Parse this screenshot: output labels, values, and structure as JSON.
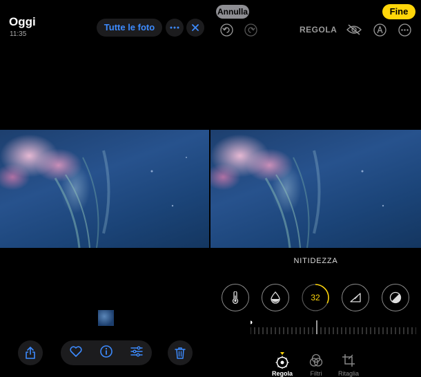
{
  "left": {
    "title": "Oggi",
    "time": "11:35",
    "all_photos_label": "Tutte le foto",
    "icons": {
      "more": "ellipsis-icon",
      "close": "close-icon",
      "share": "share-icon",
      "favorite": "heart-icon",
      "info": "info-icon",
      "adjust": "sliders-icon",
      "delete": "trash-icon"
    }
  },
  "right": {
    "cancel_label": "Annulla",
    "done_label": "Fine",
    "header_label": "REGOLA",
    "mode_label": "NITIDEZZA",
    "sharpness_value": "32",
    "sharpness_level": 0.32,
    "tools": [
      "thermometer-icon",
      "drop-icon",
      "sharpness-dial",
      "triangle-icon",
      "contrast-icon"
    ],
    "tabs": [
      {
        "label": "Regola",
        "icon": "adjust-dial-icon",
        "active": true
      },
      {
        "label": "Filtri",
        "icon": "filters-icon",
        "active": false
      },
      {
        "label": "Ritaglia",
        "icon": "crop-icon",
        "active": false
      }
    ],
    "colors": {
      "accent_yellow": "#ffd60a",
      "link_blue": "#3d8bff"
    }
  }
}
